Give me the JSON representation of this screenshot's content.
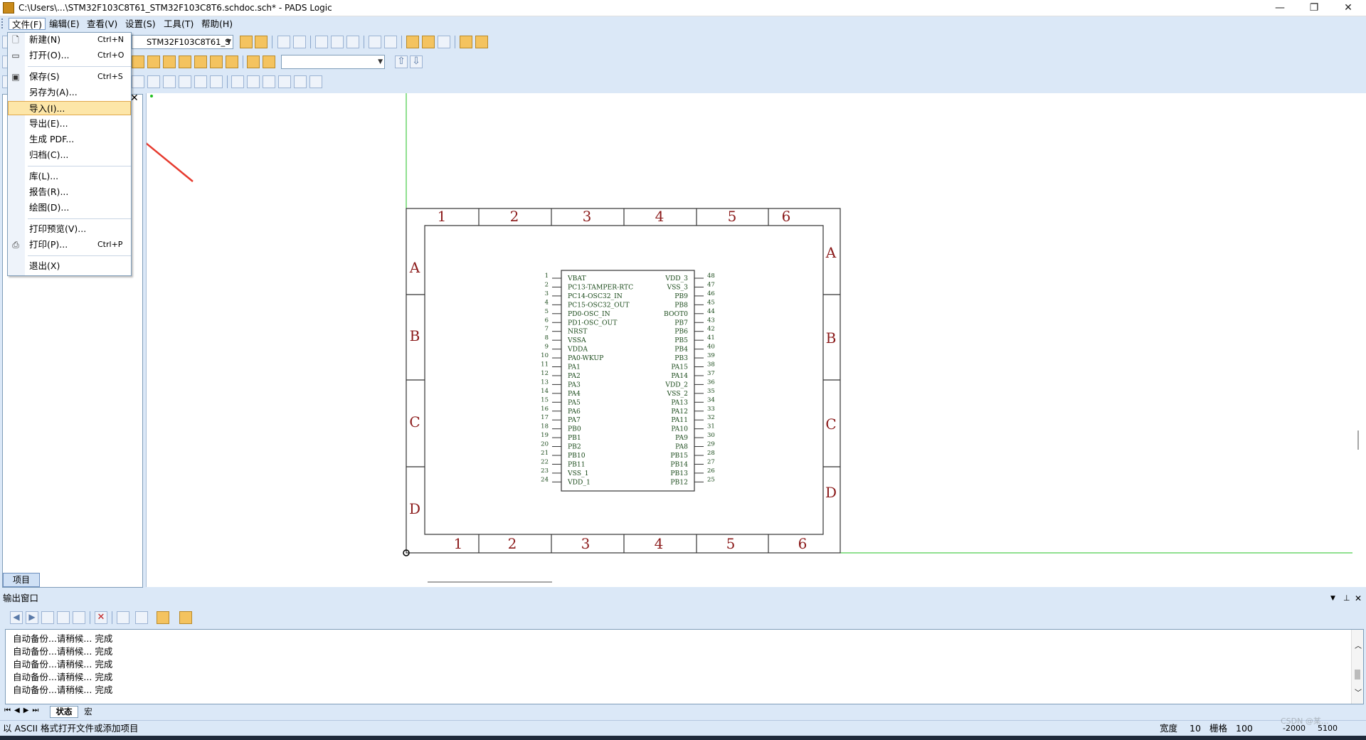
{
  "window": {
    "title": "C:\\Users\\...\\STM32F103C8T61_STM32F103C8T6.schdoc.sch* - PADS Logic",
    "controls": {
      "minimize": "—",
      "maximize": "❐",
      "close": "✕"
    }
  },
  "menubar": [
    {
      "label": "文件(F)",
      "active": true
    },
    {
      "label": "编辑(E)"
    },
    {
      "label": "查看(V)"
    },
    {
      "label": "设置(S)"
    },
    {
      "label": "工具(T)"
    },
    {
      "label": "帮助(H)"
    }
  ],
  "toolbar": {
    "sheet_combo": "STM32F103C8T61_S",
    "second_combo": ""
  },
  "file_menu": [
    {
      "label": "新建(N)",
      "shortcut": "Ctrl+N",
      "icon": "new-file-icon"
    },
    {
      "label": "打开(O)...",
      "shortcut": "Ctrl+O",
      "icon": "open-folder-icon"
    },
    {
      "separator": true
    },
    {
      "label": "保存(S)",
      "shortcut": "Ctrl+S",
      "icon": "save-icon"
    },
    {
      "label": "另存为(A)..."
    },
    {
      "label": "导入(I)...",
      "selected": true
    },
    {
      "label": "导出(E)..."
    },
    {
      "label": "生成 PDF..."
    },
    {
      "label": "归档(C)..."
    },
    {
      "separator": true
    },
    {
      "label": "库(L)..."
    },
    {
      "label": "报告(R)..."
    },
    {
      "label": "绘图(D)..."
    },
    {
      "separator": true
    },
    {
      "label": "打印预览(V)..."
    },
    {
      "label": "打印(P)...",
      "shortcut": "Ctrl+P",
      "icon": "printer-icon"
    },
    {
      "separator": true
    },
    {
      "label": "退出(X)"
    }
  ],
  "left_panel": {
    "tab_label": "项目",
    "close": "✕"
  },
  "schematic": {
    "border_cols_top": [
      "1",
      "2",
      "3",
      "4",
      "5",
      "6"
    ],
    "border_cols_bottom": [
      "1",
      "2",
      "3",
      "4",
      "5",
      "6"
    ],
    "border_rows_left": [
      "A",
      "B",
      "C",
      "D"
    ],
    "border_rows_right": [
      "A",
      "B",
      "C",
      "D"
    ],
    "left_pins": [
      {
        "num": "1",
        "name": "VBAT"
      },
      {
        "num": "2",
        "name": "PC13-TAMPER-RTC"
      },
      {
        "num": "3",
        "name": "PC14-OSC32_IN"
      },
      {
        "num": "4",
        "name": "PC15-OSC32_OUT"
      },
      {
        "num": "5",
        "name": "PD0-OSC_IN"
      },
      {
        "num": "6",
        "name": "PD1-OSC_OUT"
      },
      {
        "num": "7",
        "name": "NRST"
      },
      {
        "num": "8",
        "name": "VSSA"
      },
      {
        "num": "9",
        "name": "VDDA"
      },
      {
        "num": "10",
        "name": "PA0-WKUP"
      },
      {
        "num": "11",
        "name": "PA1"
      },
      {
        "num": "12",
        "name": "PA2"
      },
      {
        "num": "13",
        "name": "PA3"
      },
      {
        "num": "14",
        "name": "PA4"
      },
      {
        "num": "15",
        "name": "PA5"
      },
      {
        "num": "16",
        "name": "PA6"
      },
      {
        "num": "17",
        "name": "PA7"
      },
      {
        "num": "18",
        "name": "PB0"
      },
      {
        "num": "19",
        "name": "PB1"
      },
      {
        "num": "20",
        "name": "PB2"
      },
      {
        "num": "21",
        "name": "PB10"
      },
      {
        "num": "22",
        "name": "PB11"
      },
      {
        "num": "23",
        "name": "VSS_1"
      },
      {
        "num": "24",
        "name": "VDD_1"
      }
    ],
    "right_pins": [
      {
        "num": "48",
        "name": "VDD_3"
      },
      {
        "num": "47",
        "name": "VSS_3"
      },
      {
        "num": "46",
        "name": "PB9"
      },
      {
        "num": "45",
        "name": "PB8"
      },
      {
        "num": "44",
        "name": "BOOT0"
      },
      {
        "num": "43",
        "name": "PB7"
      },
      {
        "num": "42",
        "name": "PB6"
      },
      {
        "num": "41",
        "name": "PB5"
      },
      {
        "num": "40",
        "name": "PB4"
      },
      {
        "num": "39",
        "name": "PB3"
      },
      {
        "num": "38",
        "name": "PA15"
      },
      {
        "num": "37",
        "name": "PA14"
      },
      {
        "num": "36",
        "name": "VDD_2"
      },
      {
        "num": "35",
        "name": "VSS_2"
      },
      {
        "num": "34",
        "name": "PA13"
      },
      {
        "num": "33",
        "name": "PA12"
      },
      {
        "num": "32",
        "name": "PA11"
      },
      {
        "num": "31",
        "name": "PA10"
      },
      {
        "num": "30",
        "name": "PA9"
      },
      {
        "num": "29",
        "name": "PA8"
      },
      {
        "num": "28",
        "name": "PB15"
      },
      {
        "num": "27",
        "name": "PB14"
      },
      {
        "num": "26",
        "name": "PB13"
      },
      {
        "num": "25",
        "name": "PB12"
      }
    ]
  },
  "output": {
    "title": "输出窗口",
    "lines": [
      "自动备份...请稍候...  完成",
      "自动备份...请稍候...  完成",
      "自动备份...请稍候...  完成",
      "自动备份...请稍候...  完成",
      "自动备份...请稍候...  完成"
    ],
    "tabs": [
      "状态",
      "宏"
    ]
  },
  "status": {
    "message": "以 ASCII 格式打开文件或添加项目",
    "width_label": "宽度",
    "width_value": "10",
    "grid_label": "栅格",
    "grid_value": "100",
    "coord_x": "-2000",
    "coord_y": "5100",
    "watermark": "CSDN @某..."
  },
  "colors": {
    "chrome": "#dbe8f7",
    "zone_text": "#8b1a1a",
    "pin_text": "#1a4a1a",
    "origin_line": "#22c022",
    "annotation_arrow": "#e63a2e"
  }
}
